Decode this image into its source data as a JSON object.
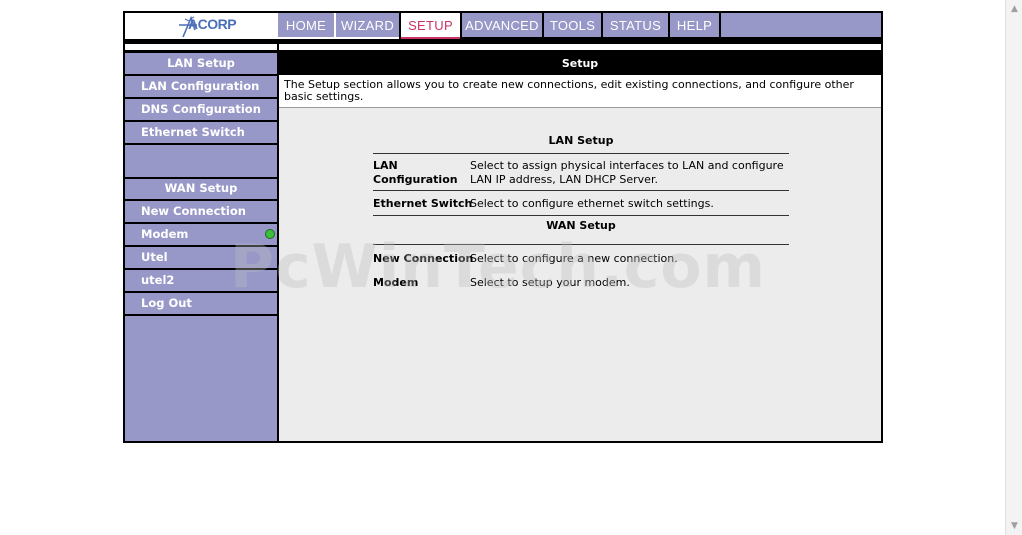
{
  "logo": {
    "text": "ACORP"
  },
  "nav": {
    "tabs": [
      "HOME",
      "WIZARD",
      "SETUP",
      "ADVANCED",
      "TOOLS",
      "STATUS",
      "HELP"
    ],
    "active": "SETUP"
  },
  "sidebar": {
    "lan_header": "LAN Setup",
    "lan_items": [
      "LAN Configuration",
      "DNS Configuration",
      "Ethernet Switch"
    ],
    "wan_header": "WAN Setup",
    "wan_items": [
      "New Connection",
      "Modem",
      "Utel",
      "utel2",
      "Log Out"
    ],
    "modem_status_color": "#3cc03c"
  },
  "main": {
    "title": "Setup",
    "description": "The Setup section allows you to create new connections, edit existing connections, and configure other basic settings.",
    "lan_section": "LAN Setup",
    "lan_rows": [
      {
        "label": "LAN Configuration",
        "text": "Select to assign physical interfaces to LAN and configure LAN IP address, LAN DHCP Server."
      },
      {
        "label": "Ethernet Switch",
        "text": "Select to configure ethernet switch settings."
      }
    ],
    "wan_section": "WAN Setup",
    "wan_rows": [
      {
        "label": "New Connection",
        "text": "Select to configure a new connection."
      },
      {
        "label": "Modem",
        "text": "Select to setup your modem."
      }
    ]
  },
  "watermark": "PcWinTech.com",
  "colors": {
    "nav_bg": "#9797c8",
    "active_tab": "#cc3366",
    "frame": "#000000"
  }
}
